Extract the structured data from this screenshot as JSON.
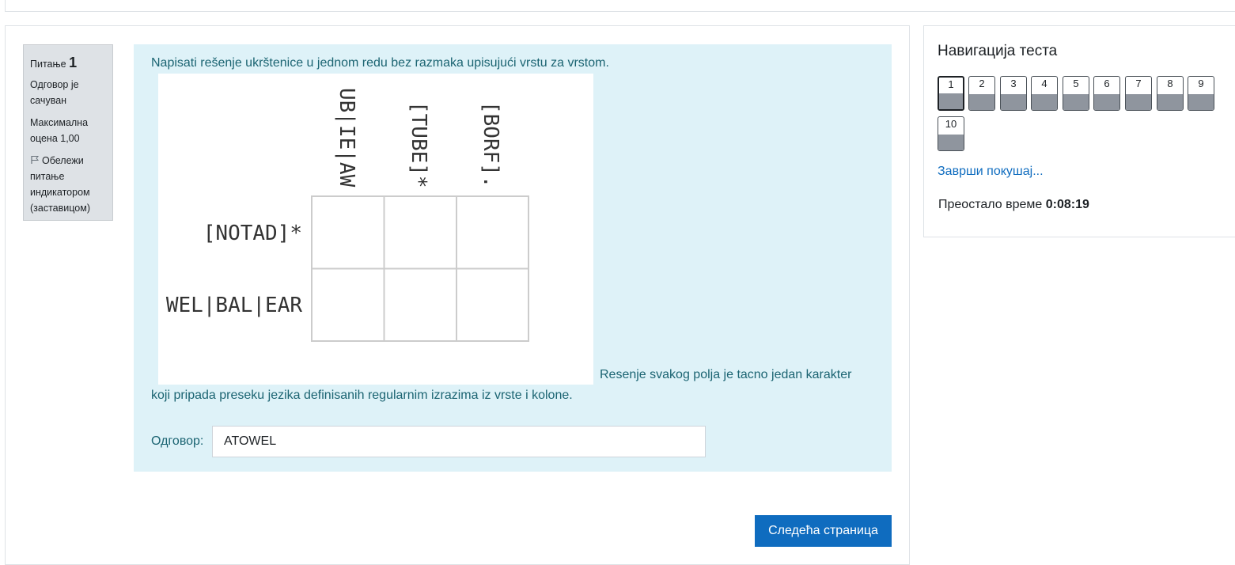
{
  "question_info": {
    "label": "Питање",
    "number": "1",
    "state": "Одговор је сачуван",
    "grade": "Максимална оцена 1,00",
    "flag_label": "Обележи питање индикатором (заставицом)"
  },
  "question": {
    "text_intro": "Napisati rešenje ukrštenice u jednom redu bez razmaka upisujući vrstu za vrstom.",
    "text_after_image_1": "Resenje svakog polja je tacno jedan karakter",
    "text_after_image_2": "koji pripada preseku jezika definisanih regularnim izrazima iz vrste i kolone.",
    "puzzle": {
      "column_regexes": [
        "UB|IE|AW",
        "[TUBE]*",
        "[BORF]."
      ],
      "row_regexes": [
        "[NOTAD]*",
        "WEL|BAL|EAR"
      ]
    },
    "answer_label": "Одговор:",
    "answer_value": "ATOWEL"
  },
  "next_button": "Следећа страница",
  "navigation": {
    "title": "Навигација теста",
    "buttons": [
      "1",
      "2",
      "3",
      "4",
      "5",
      "6",
      "7",
      "8",
      "9",
      "10"
    ],
    "current": "1",
    "finish_link": "Заврши покушај...",
    "time_label": "Преостало време",
    "time_value": "0:08:19"
  }
}
